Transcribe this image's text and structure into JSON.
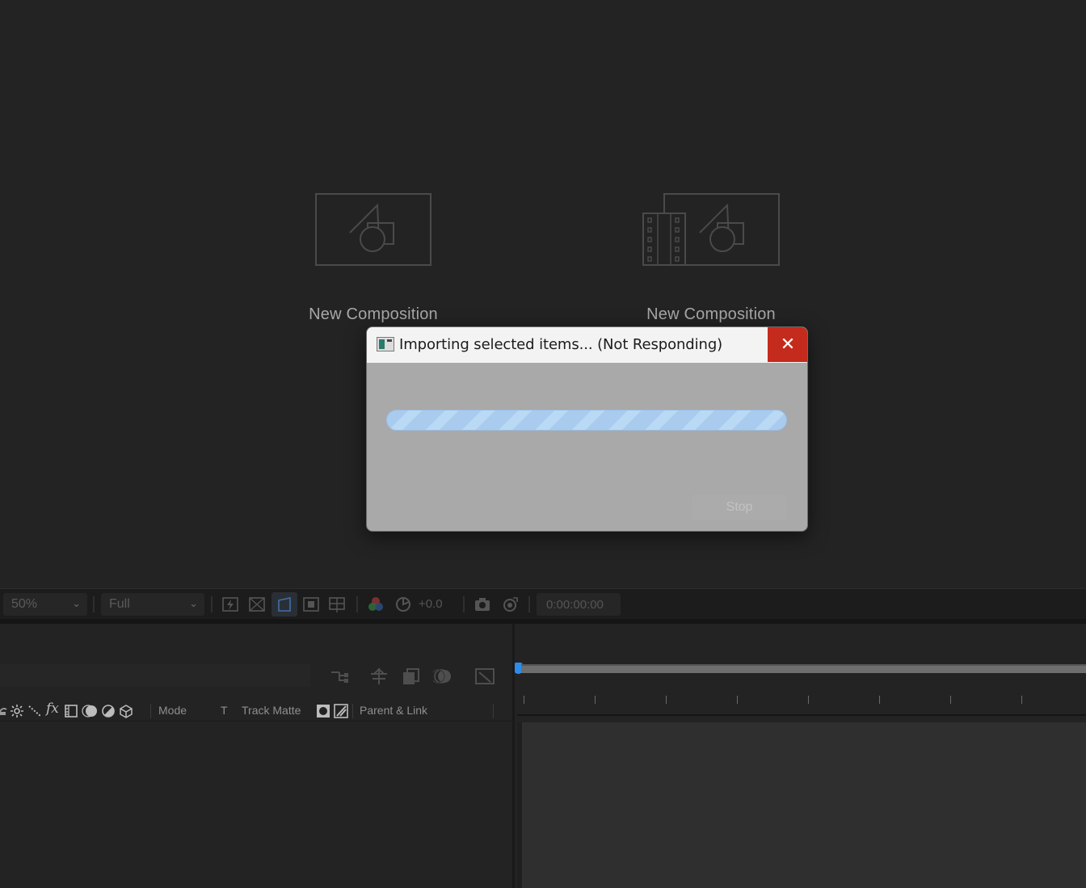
{
  "viewer": {
    "cards": [
      {
        "label": "New Composition",
        "icon": "new-composition-icon"
      },
      {
        "label": "New Composition",
        "icon": "new-composition-from-footage-icon"
      }
    ]
  },
  "viewer_toolbar": {
    "zoom": "50%",
    "resolution": "Full",
    "exposure": "+0.0",
    "timecode": "0:00:00:00"
  },
  "timeline": {
    "columns": {
      "mode": "Mode",
      "t": "T",
      "track_matte": "Track Matte",
      "parent_link": "Parent & Link"
    }
  },
  "dialog": {
    "title": "Importing selected items... (Not Responding)",
    "close_glyph": "✕",
    "stop_label": "Stop"
  },
  "colors": {
    "progress": "#a9cbee",
    "close_button": "#c42b1c",
    "playhead": "#2d8ceb"
  }
}
